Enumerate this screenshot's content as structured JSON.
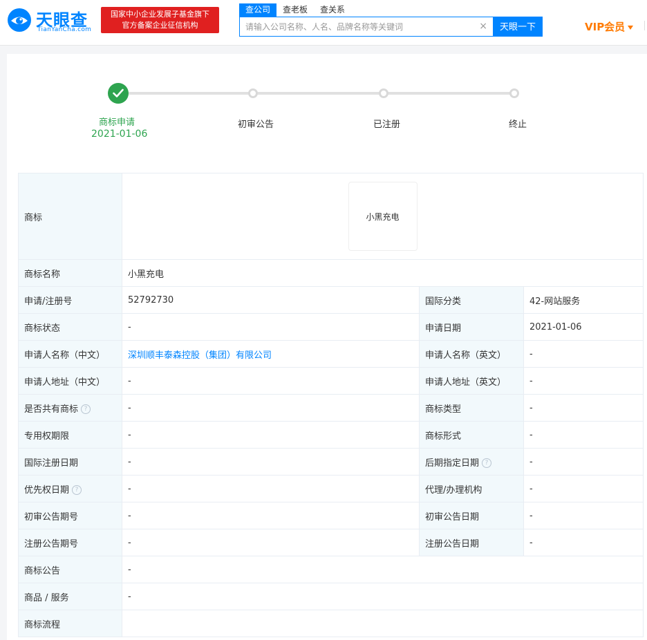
{
  "brand": {
    "title": "天眼查",
    "subtitle": "TianYanCha.com",
    "badge_line1": "国家中小企业发展子基金旗下",
    "badge_line2": "官方备案企业征信机构"
  },
  "search": {
    "tabs": [
      "查公司",
      "查老板",
      "查关系"
    ],
    "placeholder": "请输入公司名称、人名、品牌名称等关键词",
    "button_label": "天眼一下",
    "clear_label": "×"
  },
  "vip_label": "VIP会员",
  "colors": {
    "accent": "#0084ff",
    "success": "#2ea44f",
    "badge": "#e02020",
    "vip": "#ff7a00"
  },
  "progress": {
    "steps": [
      {
        "label": "商标申请",
        "date": "2021-01-06",
        "done": true
      },
      {
        "label": "初审公告",
        "done": false
      },
      {
        "label": "已注册",
        "done": false
      },
      {
        "label": "终止",
        "done": false
      }
    ]
  },
  "trademark": {
    "image_label": "商标",
    "image_text": "小黑充电",
    "name_label": "商标名称",
    "name_value": "小黑充电",
    "pairs": [
      {
        "l1": "申请/注册号",
        "v1": "52792730",
        "l2": "国际分类",
        "v2": "42-网站服务"
      },
      {
        "l1": "商标状态",
        "v1": "-",
        "l2": "申请日期",
        "v2": "2021-01-06"
      },
      {
        "l1": "申请人名称（中文）",
        "v1": "深圳顺丰泰森控股（集团）有限公司",
        "l2": "申请人名称（英文）",
        "v2": "-"
      },
      {
        "l1": "申请人地址（中文）",
        "v1": "-",
        "l2": "申请人地址（英文）",
        "v2": "-"
      },
      {
        "l1": "是否共有商标",
        "v1": "-",
        "l2": "商标类型",
        "v2": "-"
      },
      {
        "l1": "专用权期限",
        "v1": "-",
        "l2": "商标形式",
        "v2": "-"
      },
      {
        "l1": "国际注册日期",
        "v1": "-",
        "l2": "后期指定日期",
        "v2": "-"
      },
      {
        "l1": "优先权日期",
        "v1": "-",
        "l2": "代理/办理机构",
        "v2": "-"
      },
      {
        "l1": "初审公告期号",
        "v1": "-",
        "l2": "初审公告日期",
        "v2": "-"
      },
      {
        "l1": "注册公告期号",
        "v1": "-",
        "l2": "注册公告日期",
        "v2": "-"
      }
    ],
    "announcement_label": "商标公告",
    "announcement_value": "-",
    "goods_label": "商品 / 服务",
    "goods_value": "-",
    "flow_label": "商标流程",
    "flow_value": "",
    "help_glyph": "?"
  }
}
